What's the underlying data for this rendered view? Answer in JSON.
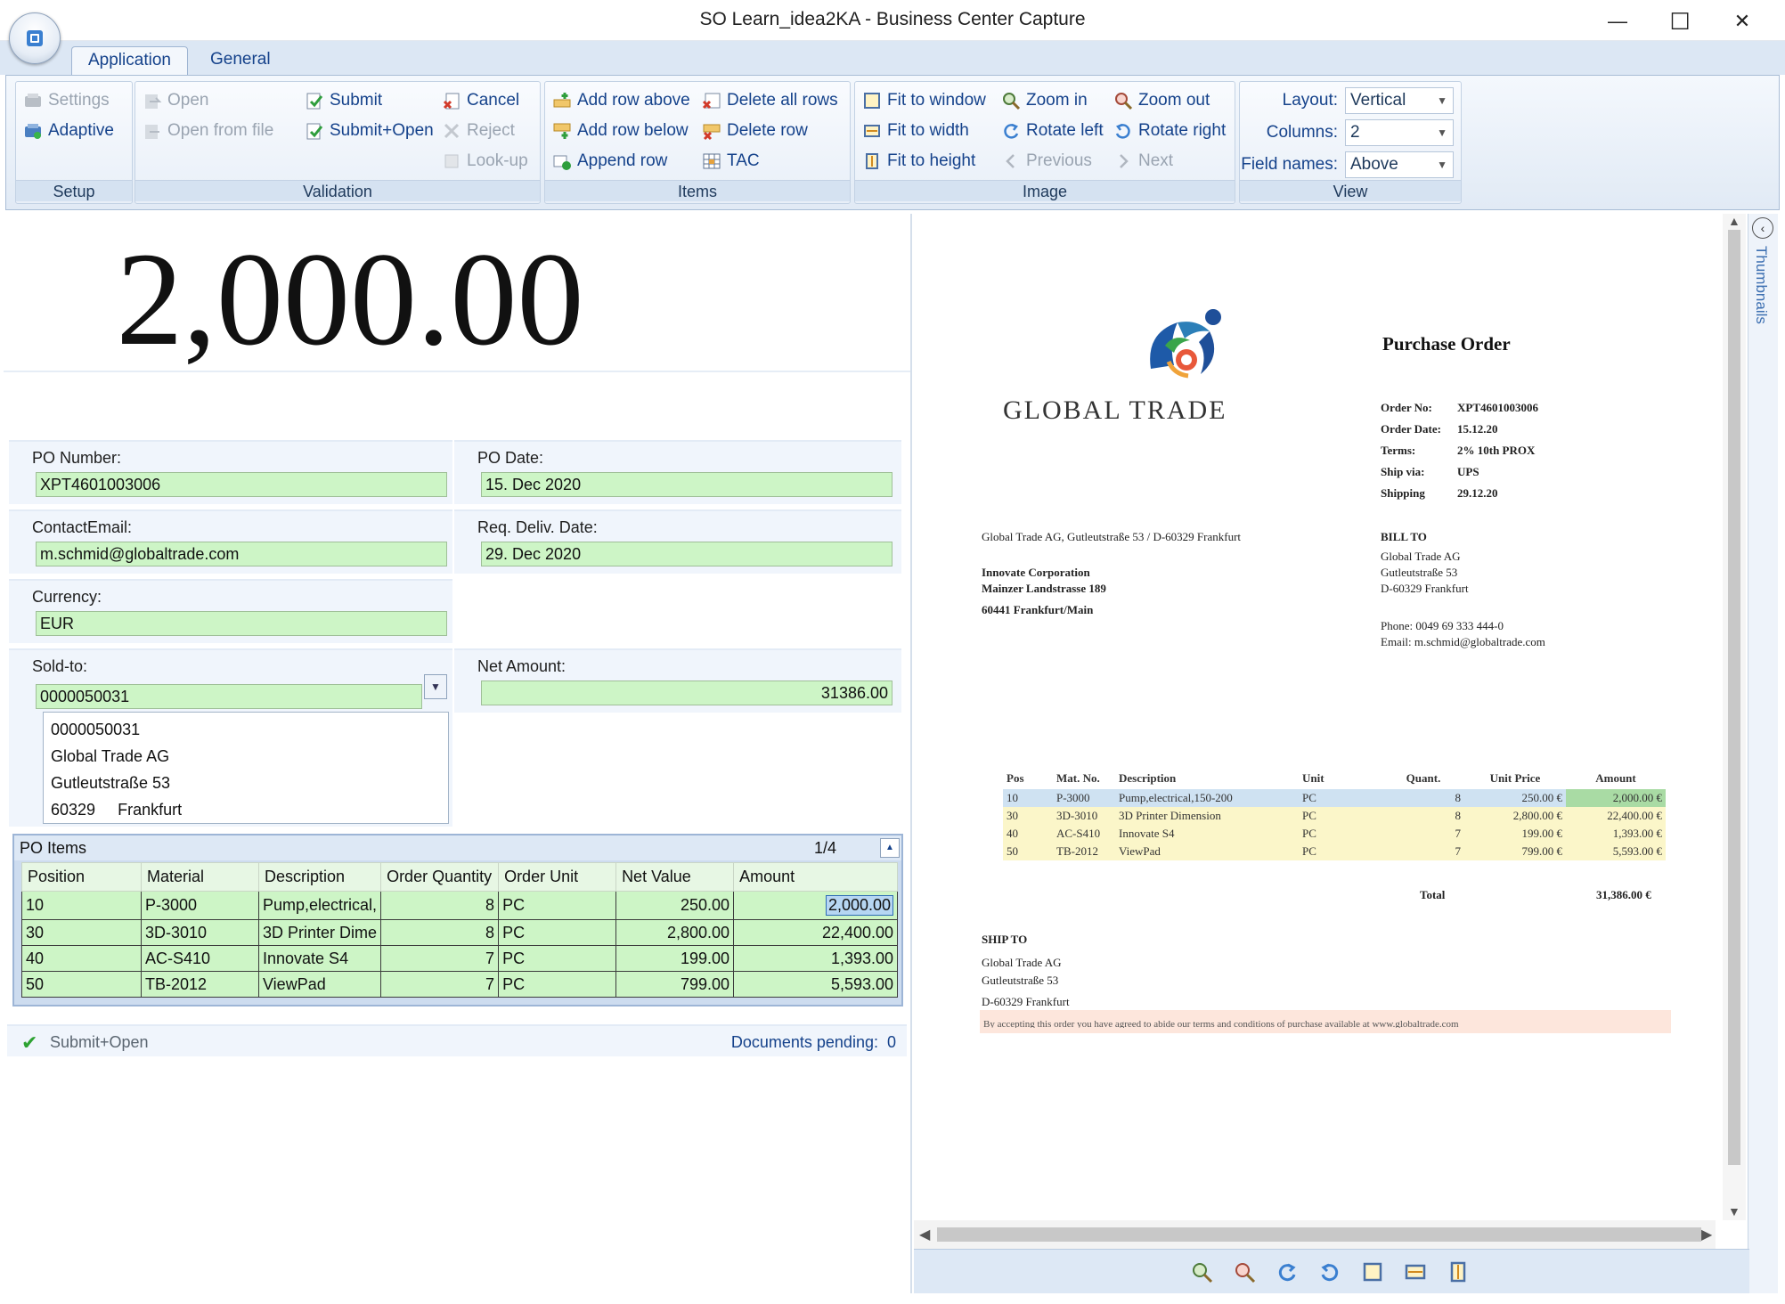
{
  "window": {
    "title": "SO Learn_idea2KA - Business Center Capture",
    "minimize": "—",
    "maximize": "☐",
    "close": "✕"
  },
  "tabs": [
    {
      "label": "Application",
      "active": true
    },
    {
      "label": "General",
      "active": false
    }
  ],
  "ribbon": {
    "setup": {
      "label": "Setup",
      "settings": "Settings",
      "adaptive": "Adaptive"
    },
    "validation": {
      "label": "Validation",
      "open": "Open",
      "open_from_file": "Open from file",
      "submit": "Submit",
      "submit_open": "Submit+Open",
      "cancel": "Cancel",
      "reject": "Reject",
      "look_up": "Look-up"
    },
    "items": {
      "label": "Items",
      "add_row_above": "Add row above",
      "add_row_below": "Add row below",
      "append_row": "Append row",
      "delete_all_rows": "Delete all rows",
      "delete_row": "Delete row",
      "tac": "TAC"
    },
    "image": {
      "label": "Image",
      "fit_to_window": "Fit to window",
      "fit_to_width": "Fit to width",
      "fit_to_height": "Fit to height",
      "zoom_in": "Zoom in",
      "rotate_left": "Rotate left",
      "previous": "Previous",
      "zoom_out": "Zoom out",
      "rotate_right": "Rotate right",
      "next": "Next"
    },
    "view": {
      "label": "View",
      "layout_label": "Layout:",
      "layout_value": "Vertical",
      "columns_label": "Columns:",
      "columns_value": "2",
      "field_names_label": "Field names:",
      "field_names_value": "Above"
    }
  },
  "capture": {
    "big_value": "2,000.00",
    "fields": {
      "po_number": {
        "label": "PO Number:",
        "value": "XPT4601003006"
      },
      "po_date": {
        "label": "PO Date:",
        "value": "15. Dec 2020"
      },
      "contact_email": {
        "label": "ContactEmail:",
        "value": "m.schmid@globaltrade.com"
      },
      "req_deliv_date": {
        "label": "Req. Deliv. Date:",
        "value": "29. Dec 2020"
      },
      "currency": {
        "label": "Currency:",
        "value": "EUR"
      },
      "sold_to": {
        "label": "Sold-to:",
        "value": "0000050031"
      },
      "net_amount": {
        "label": "Net Amount:",
        "value": "31386.00"
      }
    },
    "sold_to_address": {
      "line1": "0000050031",
      "line2": "Global Trade AG",
      "line3": "Gutleutstraße 53",
      "zip": "60329",
      "city": "Frankfurt"
    },
    "po_items": {
      "title": "PO Items",
      "page": "1/4",
      "columns": [
        "Position",
        "Material",
        "Description",
        "Order Quantity",
        "Order Unit",
        "Net Value",
        "Amount"
      ],
      "rows": [
        [
          "10",
          "P-3000",
          "Pump,electrical,",
          "8",
          "PC",
          "250.00",
          "2,000.00"
        ],
        [
          "30",
          "3D-3010",
          "3D Printer Dime",
          "8",
          "PC",
          "2,800.00",
          "22,400.00"
        ],
        [
          "40",
          "AC-S410",
          "Innovate S4",
          "7",
          "PC",
          "199.00",
          "1,393.00"
        ],
        [
          "50",
          "TB-2012",
          "ViewPad",
          "7",
          "PC",
          "799.00",
          "5,593.00"
        ]
      ]
    },
    "status": {
      "mode": "Submit+Open",
      "pending_label": "Documents pending:",
      "pending_count": "0"
    }
  },
  "viewer": {
    "thumbnails_label": "Thumbnails",
    "doc": {
      "company": "GLOBAL TRADE",
      "title": "Purchase Order",
      "order_no_label": "Order No:",
      "order_no": "XPT4601003006",
      "order_date_label": "Order Date:",
      "order_date": "15.12.20",
      "terms_label": "Terms:",
      "terms": "2% 10th PROX",
      "ship_via_label": "Ship via:",
      "ship_via": "UPS",
      "shipping_label": "Shipping",
      "shipping": "29.12.20",
      "sender_line": "Global Trade AG, Gutleutstraße 53 / D-60329 Frankfurt",
      "recipient": [
        "Innovate Corporation",
        "Mainzer Landstrasse 189",
        "60441 Frankfurt/Main"
      ],
      "bill_to_label": "BILL TO",
      "bill_to": [
        "Global Trade AG",
        "Gutleutstraße 53",
        "D-60329 Frankfurt"
      ],
      "phone": "Phone: 0049 69 333 444-0",
      "email": "Email: m.schmid@globaltrade.com",
      "table_headers": [
        "Pos",
        "Mat. No.",
        "Description",
        "Unit",
        "Quant.",
        "Unit Price",
        "Amount"
      ],
      "table_rows": [
        [
          "10",
          "P-3000",
          "Pump,electrical,150-200",
          "PC",
          "8",
          "250.00 €",
          "2,000.00 €"
        ],
        [
          "30",
          "3D-3010",
          "3D Printer Dimension",
          "PC",
          "8",
          "2,800.00 €",
          "22,400.00 €"
        ],
        [
          "40",
          "AC-S410",
          "Innovate S4",
          "PC",
          "7",
          "199.00 €",
          "1,393.00 €"
        ],
        [
          "50",
          "TB-2012",
          "ViewPad",
          "PC",
          "7",
          "799.00 €",
          "5,593.00 €"
        ]
      ],
      "total_label": "Total",
      "total": "31,386.00 €",
      "ship_to_label": "SHIP TO",
      "ship_to": [
        "Global Trade AG",
        "Gutleutstraße 53",
        "D-60329 Frankfurt"
      ],
      "footer_note": "By accepting this order you have agreed to abide our terms and conditions of purchase available at www.globaltrade.com"
    }
  }
}
